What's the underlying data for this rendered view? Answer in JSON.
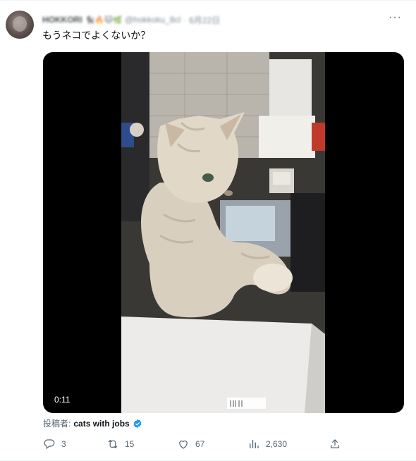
{
  "tweet": {
    "author_name": "HOKKORI",
    "author_emojis": "🐈‍⬛🔥🐱🌿",
    "handle": "@hokkoku_8cl",
    "separator": "·",
    "date": "6月22日",
    "more_icon": "more-horizontal-icon",
    "text": "もうネコでよくないか？"
  },
  "media": {
    "type": "video",
    "duration": "0:11"
  },
  "attribution": {
    "label": "投稿者:",
    "name": "cats with jobs",
    "verified_color": "#1d9bf0"
  },
  "actions": {
    "reply": {
      "icon": "reply-icon",
      "count": "3"
    },
    "retweet": {
      "icon": "retweet-icon",
      "count": "15"
    },
    "like": {
      "icon": "like-heart-icon",
      "count": "67"
    },
    "views": {
      "icon": "views-bar-chart-icon",
      "count": "2,630"
    },
    "share": {
      "icon": "share-icon"
    }
  },
  "colors": {
    "text_primary": "#0f1419",
    "text_secondary": "#536471",
    "accent": "#1d9bf0"
  }
}
